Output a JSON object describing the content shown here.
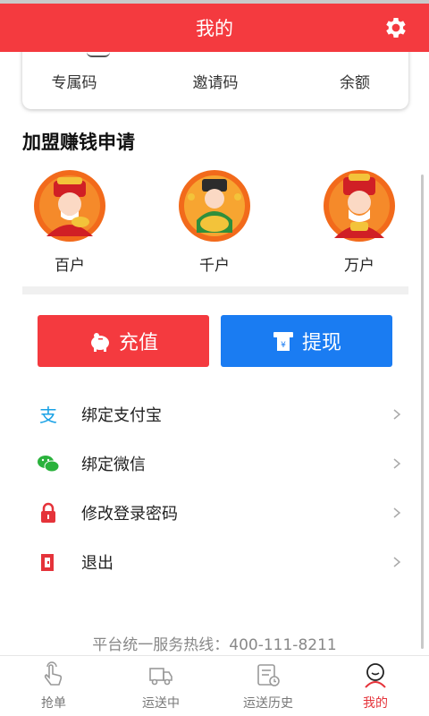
{
  "header": {
    "title": "我的",
    "settings_icon": "gear-icon"
  },
  "profile_card": {
    "items": [
      {
        "label": "专属码"
      },
      {
        "label": "邀请码"
      },
      {
        "label": "余额"
      }
    ]
  },
  "join_section": {
    "title": "加盟赚钱申请",
    "tiers": [
      {
        "label": "百户",
        "icon": "god-of-wealth-avatar"
      },
      {
        "label": "千户",
        "icon": "god-of-wealth-avatar"
      },
      {
        "label": "万户",
        "icon": "god-of-wealth-avatar"
      }
    ]
  },
  "actions": {
    "recharge": {
      "label": "充值",
      "icon": "piggy-bank-icon",
      "color": "#f43a3f"
    },
    "withdraw": {
      "label": "提现",
      "icon": "atm-icon",
      "color": "#1a7cf2"
    }
  },
  "menu": {
    "items": [
      {
        "label": "绑定支付宝",
        "icon": "alipay-icon"
      },
      {
        "label": "绑定微信",
        "icon": "wechat-icon"
      },
      {
        "label": "修改登录密码",
        "icon": "lock-icon"
      },
      {
        "label": "退出",
        "icon": "logout-icon"
      }
    ]
  },
  "footer": {
    "hotline": "平台统一服务热线：400-111-8211"
  },
  "tabbar": {
    "tabs": [
      {
        "label": "抢单",
        "icon": "tap-hand-icon"
      },
      {
        "label": "运送中",
        "icon": "delivery-truck-icon"
      },
      {
        "label": "运送历史",
        "icon": "history-list-icon"
      },
      {
        "label": "我的",
        "icon": "user-profile-icon",
        "active": true
      }
    ],
    "active_color": "#e5333a"
  }
}
